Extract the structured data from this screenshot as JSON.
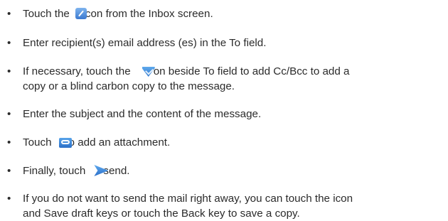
{
  "bullet_symbol": "•",
  "items": [
    {
      "before_icon": "Touch the",
      "icon": "compose-icon",
      "after_icon": "con from the Inbox screen."
    },
    {
      "text": "Enter recipient(s) email address (es) in the To field."
    },
    {
      "before_icon": "If necessary, touch the",
      "icon": "chevron-down-icon",
      "after_icon": "on beside To field to add Cc/Bcc to add a",
      "line2": "copy or a blind carbon copy to the message."
    },
    {
      "text": "Enter the subject and the content of the message."
    },
    {
      "before_icon": "Touch",
      "icon": "attachment-icon",
      "after_icon": "o add an attachment."
    },
    {
      "before_icon": "Finally, touch",
      "icon": "send-icon",
      "after_icon": "send."
    },
    {
      "text": "If you do not want to send the mail right away, you can touch the  icon",
      "line2": "and Save draft keys or touch the Back key to save a copy."
    }
  ]
}
